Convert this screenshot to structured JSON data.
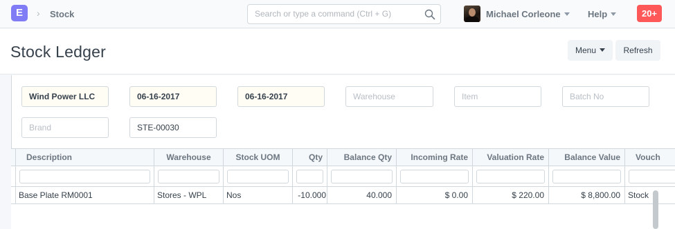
{
  "navbar": {
    "logo_letter": "E",
    "breadcrumb": "Stock",
    "search_placeholder": "Search or type a command (Ctrl + G)",
    "user_name": "Michael Corleone",
    "help_label": "Help",
    "notification_count": "20+"
  },
  "page": {
    "title": "Stock Ledger",
    "menu_label": "Menu",
    "refresh_label": "Refresh"
  },
  "filters": {
    "company": "Wind Power LLC",
    "from_date": "06-16-2017",
    "to_date": "06-16-2017",
    "warehouse_placeholder": "Warehouse",
    "item_placeholder": "Item",
    "batch_placeholder": "Batch No",
    "brand_placeholder": "Brand",
    "voucher_no": "STE-00030"
  },
  "table": {
    "columns": [
      "Description",
      "Warehouse",
      "Stock UOM",
      "Qty",
      "Balance Qty",
      "Incoming Rate",
      "Valuation Rate",
      "Balance Value",
      "Vouch"
    ],
    "rows": [
      [
        "Base Plate RM0001",
        "Stores - WPL",
        "Nos",
        "-10.000",
        "40.000",
        "$ 0.00",
        "$ 220.00",
        "$ 8,800.00",
        "Stock"
      ]
    ]
  },
  "colors": {
    "accent": "#7f7cf5",
    "notification": "#ff5858",
    "filled_filter_bg": "#fffdf4"
  }
}
